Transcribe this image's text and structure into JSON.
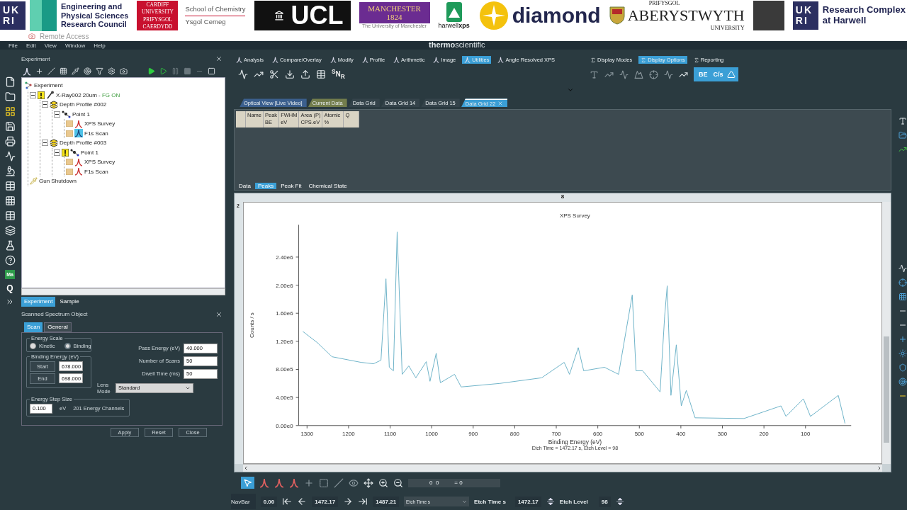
{
  "banner": {
    "logos": [
      {
        "kind": "ukri",
        "mark": [
          "UK",
          "RI"
        ],
        "caption": [
          "Engineering and",
          "Physical Sciences",
          "Research Council"
        ]
      },
      {
        "kind": "cardiff",
        "mark": [
          "CARDIFF",
          "UNIVERSITY",
          "PRIFYSGOL",
          "CAERDYDD"
        ],
        "caption": [
          "School of Chemistry",
          "Ysgol Cemeg"
        ]
      },
      {
        "kind": "ucl",
        "mark": [
          "UCL"
        ]
      },
      {
        "kind": "manchester",
        "mark": [
          "MANCHESTER",
          "1824"
        ],
        "caption": [
          "The University of Manchester"
        ]
      },
      {
        "kind": "harwell",
        "caption": [
          "harwell**xps**"
        ]
      },
      {
        "kind": "diamond",
        "caption": [
          "diamond"
        ]
      },
      {
        "kind": "aberystwyth",
        "caption": [
          "PRIFYSGOL",
          "ABERYSTWYTH",
          "UNIVERSITY"
        ]
      },
      {
        "kind": "plain"
      },
      {
        "kind": "ukri",
        "mark": [
          "UK",
          "RI"
        ],
        "caption": [
          "Research Complex",
          "at Harwell"
        ]
      }
    ],
    "remote": "Remote Access"
  },
  "menu": {
    "items": [
      "File",
      "Edit",
      "View",
      "Window",
      "Help"
    ],
    "brand": "**thermo**scientific"
  },
  "left_toolbar": {
    "badge": "Ma",
    "query": "Q"
  },
  "experiment_panel": {
    "title": "Experiment",
    "tree": {
      "label": "Experiment",
      "kind": "experiment",
      "selected": false,
      "warning": false,
      "children": [
        {
          "label": "X-Ray002 20um - ",
          "status": "FG  ON",
          "kind": "source",
          "selected": false,
          "warning": true,
          "expanded": true,
          "children": [
            {
              "label": "Depth Profile #002",
              "kind": "depth-profile",
              "selected": false,
              "warning": false,
              "expanded": true,
              "children": [
                {
                  "label": "Point 1",
                  "kind": "point",
                  "selected": false,
                  "warning": false,
                  "expanded": true,
                  "children": [
                    {
                      "label": "XPS Survey",
                      "kind": "spectrum",
                      "selected": false,
                      "warning": false
                    },
                    {
                      "label": "F1s Scan",
                      "kind": "spectrum",
                      "selected": true,
                      "warning": false
                    }
                  ]
                }
              ]
            },
            {
              "label": "Depth Profile #003",
              "kind": "depth-profile",
              "selected": false,
              "warning": false,
              "expanded": true,
              "children": [
                {
                  "label": "Point 1",
                  "kind": "point",
                  "selected": false,
                  "warning": true,
                  "expanded": true,
                  "children": [
                    {
                      "label": "XPS Survey",
                      "kind": "spectrum",
                      "selected": false,
                      "warning": false
                    },
                    {
                      "label": "F1s Scan",
                      "kind": "spectrum",
                      "selected": false,
                      "warning": false
                    }
                  ]
                }
              ]
            }
          ]
        },
        {
          "label": "Gun Shutdown",
          "kind": "gun",
          "selected": false,
          "warning": false
        }
      ]
    },
    "tabs": [
      {
        "label": "Experiment",
        "selected": true
      },
      {
        "label": "Sample",
        "selected": false
      }
    ]
  },
  "spectrum_panel": {
    "title": "Scanned Spectrum Object",
    "tabs": [
      {
        "label": "Scan",
        "selected": true
      },
      {
        "label": "General",
        "selected": false
      }
    ],
    "energy_scale": {
      "legend": "Energy Scale",
      "options": [
        {
          "label": "Kinetic",
          "selected": false
        },
        {
          "label": "Binding",
          "selected": true
        }
      ]
    },
    "binding_energy": {
      "legend": "Binding Energy (eV)",
      "rows": [
        {
          "button": "Start",
          "value": "678.000"
        },
        {
          "button": "End",
          "value": "698.000"
        }
      ]
    },
    "settings": [
      {
        "label": "Pass Energy (eV)",
        "value": "40.000"
      },
      {
        "label": "Number of Scans",
        "value": "50"
      },
      {
        "label": "Dwell Time  (ms)",
        "value": "50"
      }
    ],
    "lens_mode": {
      "label": "Lens Mode",
      "value": "Standard"
    },
    "step": {
      "legend": "Energy Step Size",
      "value": "0.100",
      "unit": "eV",
      "channels": "201 Energy Channels"
    },
    "buttons": [
      "Apply",
      "Reset",
      "Close"
    ]
  },
  "ribbon": {
    "tabs": [
      {
        "label": "Analysis",
        "selected": false
      },
      {
        "label": "Compare/Overlay",
        "selected": false
      },
      {
        "label": "Modify",
        "selected": false
      },
      {
        "label": "Profile",
        "selected": false
      },
      {
        "label": "Arithmetic",
        "selected": false
      },
      {
        "label": "Image",
        "selected": false
      },
      {
        "label": "Utilities",
        "selected": true
      },
      {
        "label": "Angle Resolved XPS",
        "selected": false
      }
    ],
    "snr": "$^{S}$N$_{R}$",
    "display_tabs": [
      {
        "label": "Display Modes",
        "selected": false
      },
      {
        "label": "Display Options",
        "selected": true
      },
      {
        "label": "Reporting",
        "selected": false
      }
    ],
    "toggles": [
      {
        "label": "BE",
        "selected": true
      },
      {
        "label": "C/s",
        "selected": true
      }
    ]
  },
  "doc_tabs": [
    {
      "label": "Optical View [Live Video]",
      "selected": false,
      "color": "#3b5f8e"
    },
    {
      "label": "Current Data",
      "selected": false,
      "color": "#737d4c"
    },
    {
      "label": "Data Grid",
      "selected": false,
      "color": "#34434a"
    },
    {
      "label": "Data Grid 14",
      "selected": false,
      "color": "#34434a"
    },
    {
      "label": "Data Grid 15",
      "selected": false,
      "color": "#34434a"
    },
    {
      "label": "Data Grid 22",
      "selected": true,
      "color": "#3b9fd6"
    }
  ],
  "grid": {
    "columns": [
      [
        "Name"
      ],
      [
        "Peak",
        "BE"
      ],
      [
        "FWHM",
        "eV"
      ],
      [
        "Area (P)",
        "CPS.eV"
      ],
      [
        "Atomic",
        "%"
      ],
      [
        "Q"
      ]
    ]
  },
  "sub_tabs": [
    {
      "label": "Data",
      "selected": false
    },
    {
      "label": "Peaks",
      "selected": true
    },
    {
      "label": "Peak Fit",
      "selected": false
    },
    {
      "label": "Chemical State",
      "selected": false
    }
  ],
  "chart_panel": {
    "header": "8",
    "side": "2",
    "chart_data": {
      "type": "line",
      "title": "XPS Survey",
      "xlabel": "Binding Energy (eV)",
      "ylabel": "Counts / s",
      "x": [
        1310,
        1275,
        1240,
        1170,
        1140,
        1122,
        1110,
        1102,
        1092,
        1083,
        1071,
        1055,
        1038,
        1013,
        1004,
        989,
        979,
        945,
        929,
        836,
        735,
        681,
        668,
        647,
        634,
        584,
        550,
        517,
        508,
        492,
        450,
        439,
        433,
        424,
        411,
        399,
        387,
        366,
        248,
        159,
        147,
        105,
        88,
        21,
        5
      ],
      "series": [
        {
          "color": "#6fb3c9",
          "values": [
            1340000,
            1180000,
            980000,
            900000,
            880000,
            930000,
            2090000,
            830000,
            780000,
            2760000,
            730000,
            850000,
            680000,
            910000,
            630000,
            1030000,
            610000,
            730000,
            550000,
            600000,
            680000,
            900000,
            730000,
            1110000,
            780000,
            830000,
            730000,
            1860000,
            780000,
            780000,
            480000,
            1560000,
            1990000,
            430000,
            1150000,
            280000,
            500000,
            110000,
            100000,
            280000,
            130000,
            380000,
            130000,
            430000,
            30000
          ]
        }
      ],
      "xlim": [
        1320,
        -10
      ],
      "ylim": [
        0,
        2860000
      ],
      "xticks": [
        1300,
        1200,
        1100,
        1000,
        900,
        800,
        700,
        600,
        500,
        400,
        300,
        200,
        100
      ],
      "yticks": [
        {
          "value": 0,
          "label": "0.00e0"
        },
        {
          "value": 400000,
          "label": "4.00e5"
        },
        {
          "value": 800000,
          "label": "8.00e5"
        },
        {
          "value": 1200000,
          "label": "1.20e6"
        },
        {
          "value": 1600000,
          "label": "1.60e6"
        },
        {
          "value": 2000000,
          "label": "2.00e6"
        },
        {
          "value": 2400000,
          "label": "2.40e6"
        }
      ],
      "annotations": [
        "Etch Time = 1472.17 s, Etch Level = 98"
      ]
    }
  },
  "plot_toolbar": {
    "readout": [
      "0  0",
      "= 0"
    ]
  },
  "navbar": {
    "label": "NavBar",
    "start": "0.00",
    "current": "1472.17",
    "end": "1487.21",
    "axis_select": "Etch Time s",
    "axis_label": "Etch Time s",
    "axis_value": "1472.17",
    "level_label": "Etch Level",
    "level_value": "98"
  }
}
